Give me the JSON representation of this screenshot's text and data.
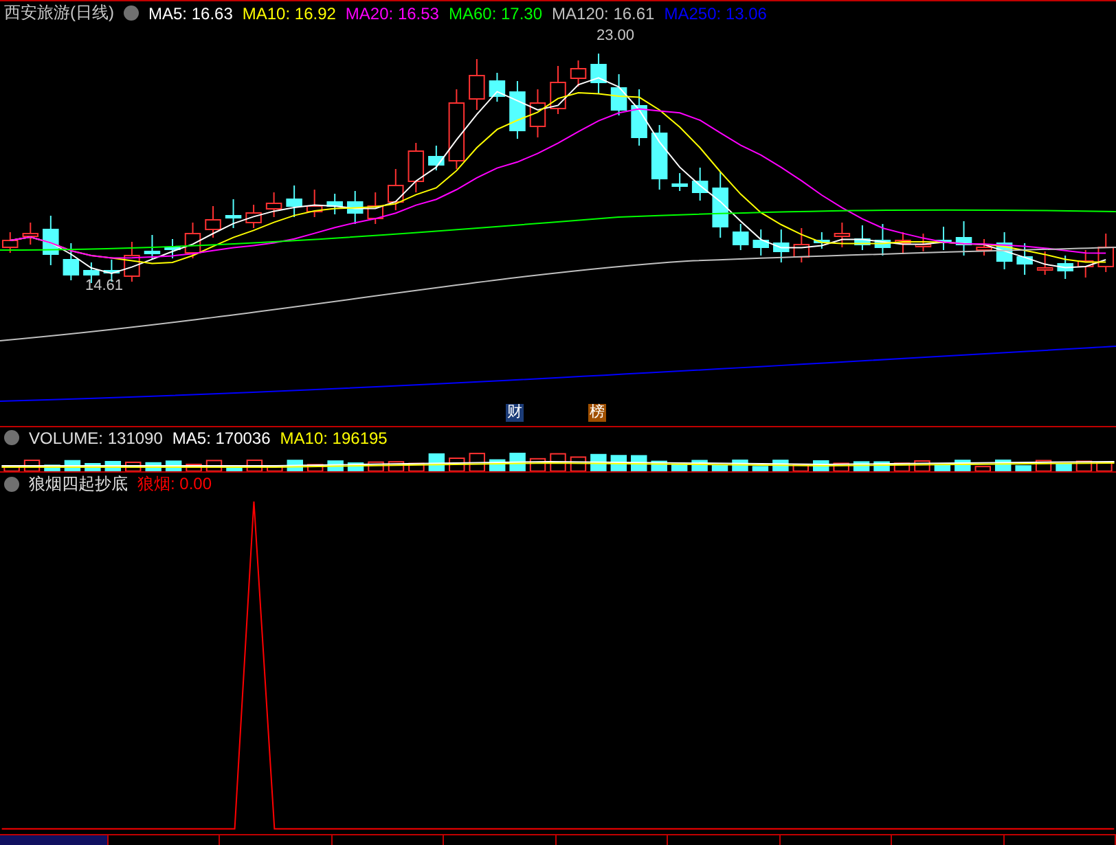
{
  "title": "西安旅游(日线)",
  "ma_legend": [
    {
      "label": "MA5: 16.63",
      "color": "#ffffff"
    },
    {
      "label": "MA10: 16.92",
      "color": "#ffff00"
    },
    {
      "label": "MA20: 16.53",
      "color": "#ff00ff"
    },
    {
      "label": "MA60: 17.30",
      "color": "#00ff00"
    },
    {
      "label": "MA120: 16.61",
      "color": "#c0c0c0"
    },
    {
      "label": "MA250: 13.06",
      "color": "#0000ff"
    }
  ],
  "price_markers": [
    {
      "text": "23.00",
      "kind": "high"
    },
    {
      "text": "14.61",
      "kind": "low"
    }
  ],
  "event_badges": [
    {
      "text": "财",
      "kind": "finance"
    },
    {
      "text": "榜",
      "kind": "ranking"
    }
  ],
  "volume": {
    "title": "VOLUME: 131090",
    "legend": [
      {
        "label": "MA5: 170036",
        "color": "#ffffff"
      },
      {
        "label": "MA10: 196195",
        "color": "#ffff00"
      }
    ]
  },
  "indicator": {
    "name": "狼烟四起抄底",
    "legend": [
      {
        "label": "狼烟: 0.00",
        "color": "#ff0000"
      }
    ]
  }
}
